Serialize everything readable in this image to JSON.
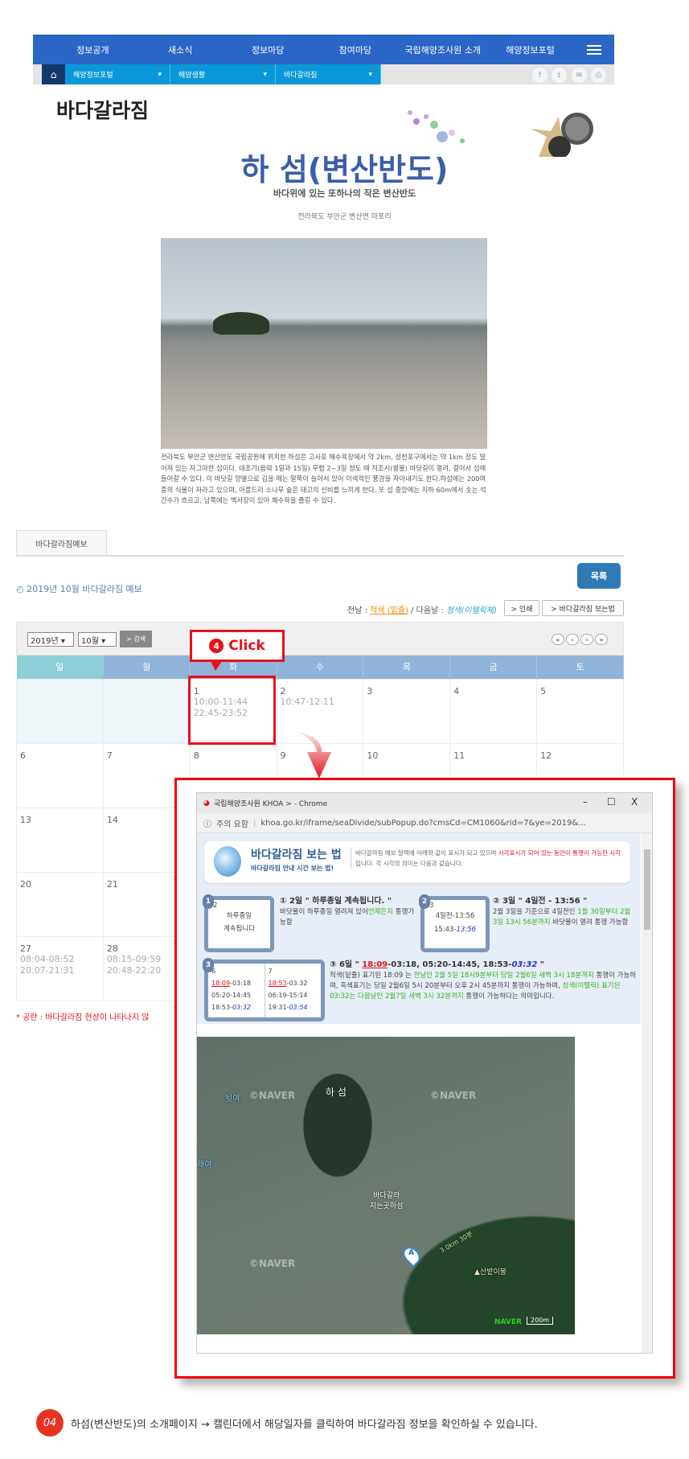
{
  "nav": {
    "items": [
      "정보공개",
      "새소식",
      "정보마당",
      "참여마당",
      "국립해양조사원 소개",
      "해양정보포털"
    ],
    "menu_icon": "hamburger-icon"
  },
  "subnav": {
    "home_icon": "home-icon",
    "dropdowns": [
      "해양정보포털",
      "해양생활",
      "바다갈라짐"
    ],
    "social": [
      "f",
      "t",
      "✉",
      "⎙"
    ]
  },
  "page": {
    "title": "바다갈라짐",
    "place_title": "하 섬(변산반도)",
    "place_subtitle": "바다위에 있는 또하나의 작은 변산반도",
    "location": "전라북도 부안군 변산면 마포리",
    "description": "전라북도 부안군 변산반도 국립공원에 위치한 하섬은 고사포 해수욕장에서 약 2km, 성천포구에서는 약 1km 정도 떨어져 있는 자그마한 섬이다. 대조기(음력 1일과 15일) 무렵 2~3일 정도 때 저조시(썰물) 바닷길이 열려, 걸어서 섬에 들어갈 수 있다. 이 바닷길 양옆으로 김을 매는 말뚝이 늘어서 있어 이색적인 풍경을 자아내기도 한다.하섬에는 200여 종의 식물이 자라고 있으며, 아름드리 소나무 숲은 태고의 신비를 느끼게 한다. 또 섬 중앙에는 지하 60m에서 솟는 석간수가 흐르고, 남쪽에는 백사장이 있어 해수욕을 즐길 수 있다."
  },
  "tab": "바다갈라짐예보",
  "list_button": "목록",
  "forecast_title": "2019년 10월 바다갈라짐 예보",
  "legend": {
    "prev_label": "전날 : ",
    "prev_value": "적색 (밑줄)",
    "sep": " / 다음날 : ",
    "next_value": "청색(이탤릭체)"
  },
  "buttons": {
    "print": "> 인쇄",
    "howto": "> 바다갈라짐 보는법",
    "search": "> 검색"
  },
  "selects": {
    "year": "2019년",
    "month": "10월"
  },
  "pager": [
    "«",
    "‹",
    "›",
    "»"
  ],
  "calendar": {
    "headers": [
      "일",
      "월",
      "화",
      "수",
      "목",
      "금",
      "토"
    ],
    "rows": [
      [
        {
          "d": "",
          "t": []
        },
        {
          "d": "",
          "t": []
        },
        {
          "d": "1",
          "t": [
            "10:00-11:44",
            "22:45-23:52"
          ]
        },
        {
          "d": "2",
          "t": [
            "10:47-12:11"
          ]
        },
        {
          "d": "3",
          "t": []
        },
        {
          "d": "4",
          "t": []
        },
        {
          "d": "5",
          "t": []
        }
      ],
      [
        {
          "d": "6",
          "t": []
        },
        {
          "d": "7",
          "t": []
        },
        {
          "d": "8",
          "t": []
        },
        {
          "d": "9",
          "t": []
        },
        {
          "d": "10",
          "t": []
        },
        {
          "d": "11",
          "t": []
        },
        {
          "d": "12",
          "t": []
        }
      ],
      [
        {
          "d": "13",
          "t": []
        },
        {
          "d": "14",
          "t": []
        }
      ],
      [
        {
          "d": "20",
          "t": []
        },
        {
          "d": "21",
          "t": []
        }
      ],
      [
        {
          "d": "27",
          "t": [
            "08:04-08:52",
            "20:07-21:31"
          ]
        },
        {
          "d": "28",
          "t": [
            "08:15-09:59",
            "20:48-22:20"
          ]
        }
      ]
    ]
  },
  "note": "* 공란 : 바다갈라짐 현상이 나타나지 않",
  "callout": {
    "number": "4",
    "label": "Click"
  },
  "popup": {
    "window_title": "국립해양조사원 KHOA > - Chrome",
    "security": "주의 요함",
    "url": "khoa.go.kr/iframe/seaDivide/subPopup.do?cmsCd=CM1060&rid=7&ye=2019&...",
    "controls": [
      "–",
      "☐",
      "X"
    ],
    "guide_title": "바다갈라짐 보는 법",
    "guide_sub": "바다갈라짐 안내 시간 보는 법!",
    "guide_desc_1": "바다갈라짐 예보 달력에 아래와 같이 표시가 되고 있으며 ",
    "guide_desc_red": "시각표시가 되어 있는 동안이 통행이 가능한 시각",
    "guide_desc_2": "입니다. 각 시각의 의미는 다음과 같습니다.",
    "item1": {
      "badge": "1",
      "day": "2",
      "box": [
        "하루종일",
        "계속됩니다"
      ],
      "title": "① 2일 \" 하루종일 계속됩니다. \"",
      "text": "바닷물이 하루종일 열려져 있어",
      "text_green": "언제든지",
      "text_2": " 통행가능함"
    },
    "item2": {
      "badge": "2",
      "day": "3",
      "box": [
        "4일전-13:56",
        "15:43-"
      ],
      "box_blue": "13:56",
      "title": "② 3일 \" 4일전 - 13:56 \"",
      "text": "2월 3일을 기준으로 4일전인 ",
      "text_green": "1월 30일부터 2월 3일 13시 56분까지",
      "text_2": " 바닷물이 열려 통행 가능함"
    },
    "item3": {
      "badge": "3",
      "col1": {
        "day": "6",
        "red": "18:09",
        "l1": "-03:18",
        "l2": "05:20-14:45",
        "l3": "18:53-",
        "blue": "03:32"
      },
      "col2": {
        "day": "7",
        "red": "18:53",
        "l1": "-03:32",
        "l2": "06:19-15:14",
        "l3": "19:31-",
        "blue": "03:54"
      },
      "title_a": "③ 6일 \" ",
      "title_red": "18:09",
      "title_b": "-03:18, 05:20-14:45, 18:53-",
      "title_blue": "03:32",
      "title_c": " \"",
      "t1": "적색(밑줄) 표기된 18:09 는 ",
      "g1": "전날인 2월 5일 18시9분부터 당일 2월6일 새벽 3시 18분까지",
      "t2": " 통행이 가능하며, 흑색표기는 당일 2월6일 5시 20분부터 오후 2시 45분까지 통행이 가능하며, ",
      "g2": "청색(이탤릭) 표기된 03:32는 다음날인 2월7일 새벽 3시 32분까지",
      "t3": " 통행이 가능하다는 의미입니다."
    },
    "map_labels": {
      "island": "하 섬",
      "rock1": "뒷여",
      "rock2": "래여",
      "crossing": "바다갈라\n지는곳하섬",
      "peak": "▲산밭이봉",
      "marker": "A",
      "brand": "NAVER",
      "watermark": "©NAVER",
      "scale": "200m",
      "trail": "3.0km 30분"
    }
  },
  "caption": {
    "badge": "04",
    "text": "하섬(변산반도)의 소개페이지 → 캘린더에서 해당일자를 클릭하여 바다갈라짐 정보을 확인하실 수 있습니다."
  },
  "colors": {
    "nav": "#2a66c5",
    "subnav_dropdown": "#0a98d8",
    "title": "#3b5ea8",
    "highlight": "#e8101a",
    "list_button": "#2f79b5"
  }
}
